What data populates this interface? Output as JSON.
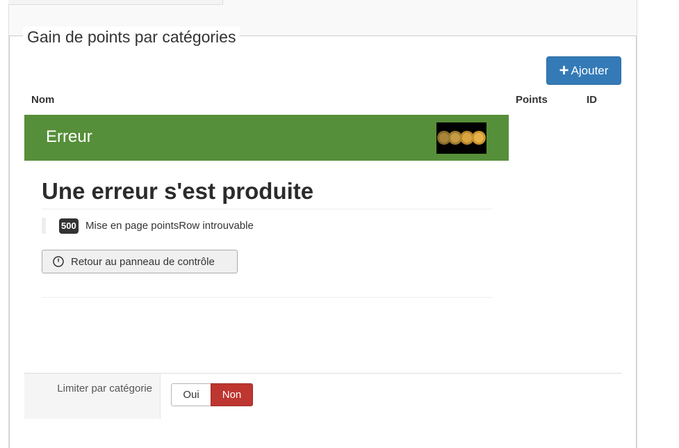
{
  "fieldset": {
    "legend": "Gain de points par catégories"
  },
  "toolbar": {
    "add_label": "Ajouter"
  },
  "table": {
    "columns": [
      "Nom",
      "Points",
      "ID"
    ]
  },
  "error": {
    "banner_title": "Erreur",
    "heading": "Une erreur s'est produite",
    "code": "500",
    "message": "Mise en page pointsRow introuvable",
    "back_label": "Retour au panneau de contrôle"
  },
  "form": {
    "limit_label": "Limiter par catégorie",
    "options": [
      "Oui",
      "Non"
    ],
    "selected": "Non"
  },
  "colors": {
    "primary": "#337ab7",
    "banner": "#568f39",
    "danger": "#bd362f"
  },
  "icons": {
    "add": "plus-icon",
    "back": "power-icon"
  }
}
